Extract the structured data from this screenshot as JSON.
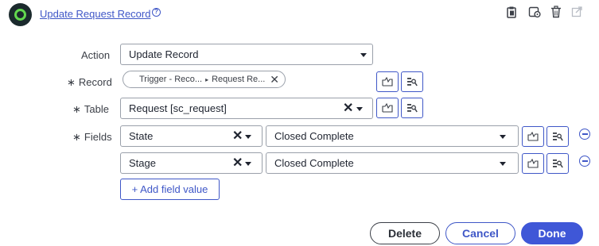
{
  "header": {
    "title": "Update Request Record",
    "help_icon": "help-circle-icon",
    "icons": [
      "clipboard-icon",
      "settings-badge-icon",
      "trash-icon",
      "open-external-icon"
    ]
  },
  "form": {
    "action": {
      "label": "Action",
      "value": "Update Record"
    },
    "record": {
      "label": "Record",
      "required_mark": "∗",
      "pill_part1": "Trigger - Reco...",
      "pill_part2": "Request Re...",
      "separator": "▸"
    },
    "table": {
      "label": "Table",
      "required_mark": "∗",
      "value": "Request [sc_request]"
    },
    "fields": {
      "label": "Fields",
      "required_mark": "∗",
      "rows": [
        {
          "field": "State",
          "value": "Closed Complete"
        },
        {
          "field": "Stage",
          "value": "Closed Complete"
        }
      ],
      "add_label": "+ Add field value"
    }
  },
  "footer": {
    "delete_label": "Delete",
    "cancel_label": "Cancel",
    "done_label": "Done"
  },
  "colors": {
    "accent": "#3f57c7",
    "primary_button": "#3f57d7",
    "logo_ring": "#62d84e"
  }
}
